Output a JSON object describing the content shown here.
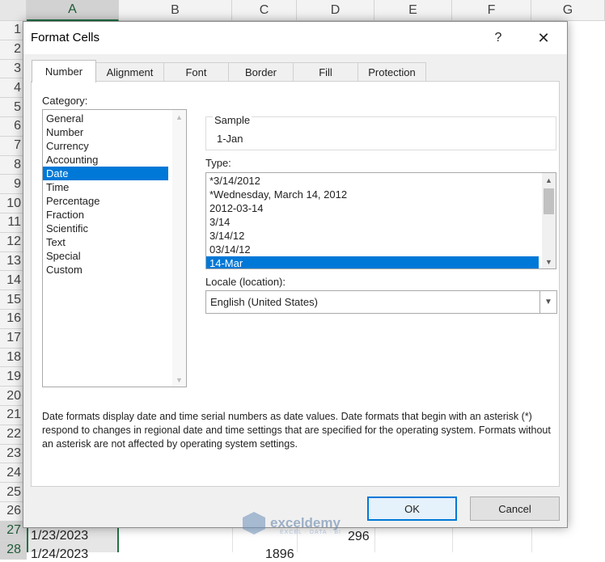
{
  "spreadsheet": {
    "columns": [
      "A",
      "B",
      "C",
      "D",
      "E",
      "F",
      "G"
    ],
    "rows": [
      "1",
      "2",
      "3",
      "4",
      "5",
      "6",
      "7",
      "8",
      "9",
      "10",
      "11",
      "12",
      "13",
      "14",
      "15",
      "16",
      "17",
      "18",
      "19",
      "20",
      "21",
      "22",
      "23",
      "24",
      "25",
      "26",
      "27",
      "28"
    ],
    "row27": {
      "a": "1/23/2023",
      "d": "296"
    },
    "row28": {
      "a": "1/24/2023",
      "c": "1896"
    }
  },
  "dialog": {
    "title": "Format Cells",
    "help": "?",
    "close": "✕",
    "tabs": [
      "Number",
      "Alignment",
      "Font",
      "Border",
      "Fill",
      "Protection"
    ],
    "category_label": "Category:",
    "categories": [
      "General",
      "Number",
      "Currency",
      "Accounting",
      "Date",
      "Time",
      "Percentage",
      "Fraction",
      "Scientific",
      "Text",
      "Special",
      "Custom"
    ],
    "selected_category": "Date",
    "sample_label": "Sample",
    "sample_value": "1-Jan",
    "type_label": "Type:",
    "types": [
      "*3/14/2012",
      "*Wednesday, March 14, 2012",
      "2012-03-14",
      "3/14",
      "3/14/12",
      "03/14/12",
      "14-Mar"
    ],
    "selected_type": "14-Mar",
    "locale_label": "Locale (location):",
    "locale_value": "English (United States)",
    "description": "Date formats display date and time serial numbers as date values.  Date formats that begin with an asterisk (*) respond to changes in regional date and time settings that are specified for the operating system. Formats without an asterisk are not affected by operating system settings.",
    "ok_label": "OK",
    "cancel_label": "Cancel"
  },
  "watermark": {
    "name": "exceldemy",
    "sub": "EXCEL · DATA · BI"
  }
}
